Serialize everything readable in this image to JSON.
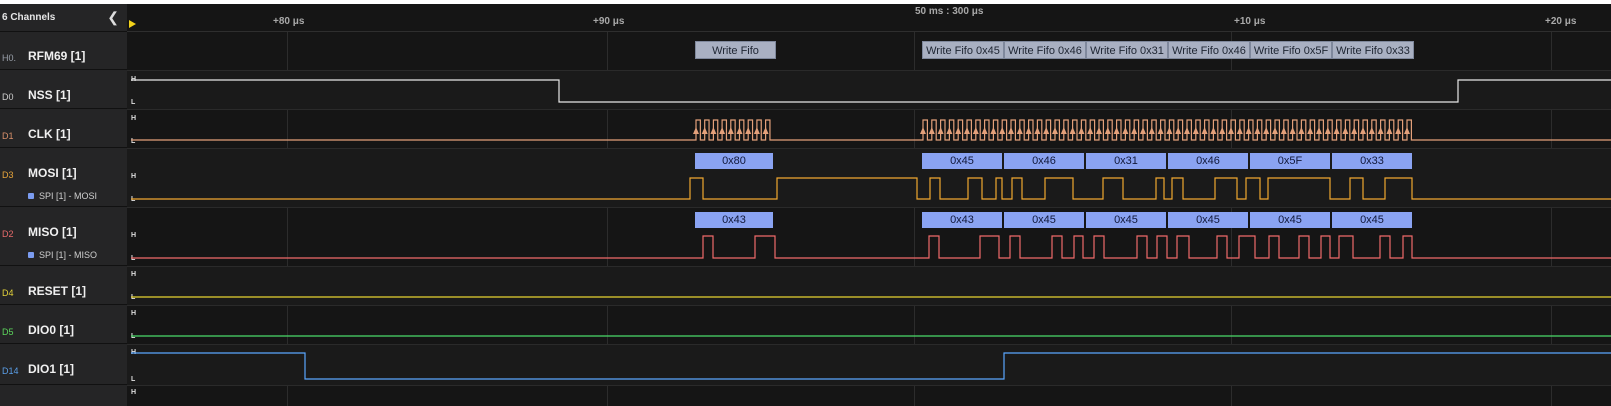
{
  "sidebar": {
    "title": "6 Channels",
    "collapse_icon": "chevron-left-icon",
    "channels": [
      {
        "index": "H0.",
        "name": "RFM69 [1]",
        "color": "#9aa0aa"
      },
      {
        "index": "D0",
        "name": "NSS [1]",
        "color": "#cfcfcf"
      },
      {
        "index": "D1",
        "name": "CLK [1]",
        "color": "#d9906a"
      },
      {
        "index": "D3",
        "name": "MOSI [1]",
        "sub": "SPI [1] - MOSI",
        "color": "#e8a53a"
      },
      {
        "index": "D2",
        "name": "MISO [1]",
        "sub": "SPI [1] - MISO",
        "color": "#e86a6a"
      },
      {
        "index": "D4",
        "name": "RESET [1]",
        "color": "#e3d23a"
      },
      {
        "index": "D5",
        "name": "DIO0 [1]",
        "color": "#5cd65c"
      },
      {
        "index": "D14",
        "name": "DIO1 [1]",
        "color": "#5a9ee8"
      }
    ]
  },
  "ruler": {
    "center": "50 ms : 300 μs",
    "ticks": [
      "+80 μs",
      "+90 μs",
      "+10 μs",
      "+20 μs"
    ]
  },
  "levels": {
    "high": "H",
    "low": "L"
  },
  "analyzer_frames": [
    "Write Fifo",
    "Write Fifo 0x45",
    "Write Fifo 0x46",
    "Write Fifo 0x31",
    "Write Fifo 0x46",
    "Write Fifo 0x5F",
    "Write Fifo 0x33"
  ],
  "mosi_frames": [
    "0x80",
    "0x45",
    "0x46",
    "0x31",
    "0x46",
    "0x5F",
    "0x33"
  ],
  "miso_frames": [
    "0x43",
    "0x43",
    "0x45",
    "0x45",
    "0x45",
    "0x45",
    "0x45"
  ],
  "colors": {
    "nss": "#e8e8e8",
    "clk": "#e3a07a",
    "mosi": "#f0a830",
    "miso": "#f06a6a",
    "reset": "#e8d431",
    "dio0": "#4bdc6a",
    "dio1": "#5aa6ff",
    "accent_marker": "#f2d21a"
  }
}
